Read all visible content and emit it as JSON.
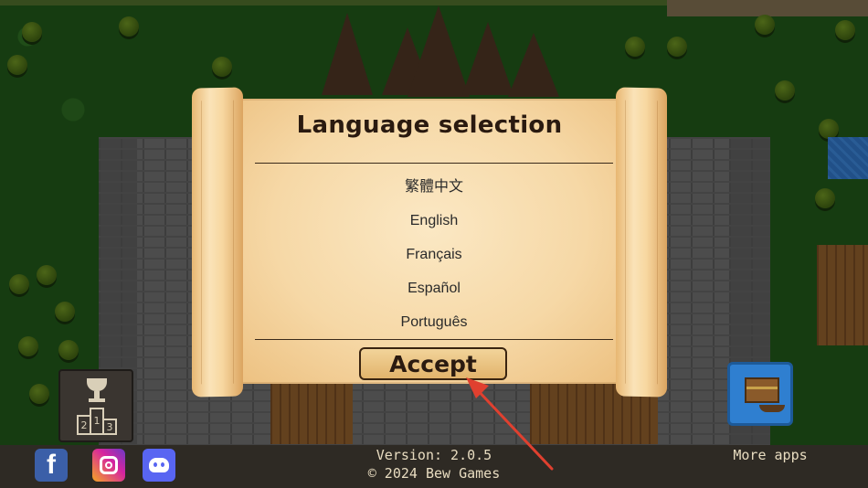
{
  "dialog": {
    "title": "Language selection",
    "languages": [
      "繁體中文",
      "English",
      "Français",
      "Español",
      "Português"
    ],
    "accept_label": "Accept"
  },
  "footer": {
    "version": "Version: 2.0.5",
    "copyright": "© 2024 Bew Games",
    "more_apps": "More apps"
  },
  "social": {
    "facebook_glyph": "f",
    "facebook_icon": "facebook-icon",
    "instagram_icon": "instagram-icon",
    "discord_icon": "discord-icon"
  },
  "podium": {
    "icon": "trophy-podium-icon",
    "steps": [
      "2",
      "1",
      "3"
    ]
  },
  "map_button": {
    "icon": "treasure-map-icon"
  },
  "colors": {
    "parchment": "#f6d8a6",
    "annotation_arrow": "#e0402f",
    "footer_bg": "#2e2a24"
  }
}
